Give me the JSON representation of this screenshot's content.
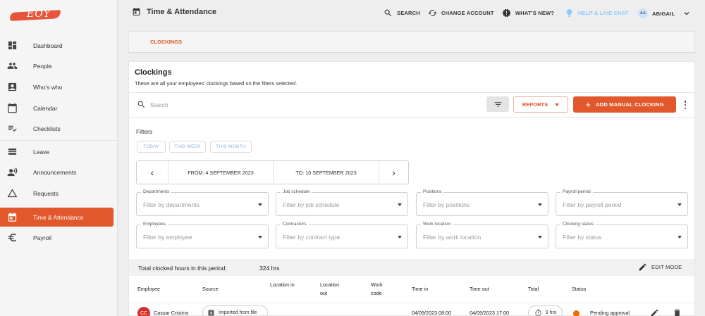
{
  "logo": {
    "text": "EOY"
  },
  "sidebar": {
    "items": [
      {
        "label": "Dashboard",
        "icon": "dashboard-icon"
      },
      {
        "label": "People",
        "icon": "people-icon"
      },
      {
        "label": "Who's who",
        "icon": "badge-icon"
      },
      {
        "label": "Calendar",
        "icon": "calendar-icon"
      },
      {
        "label": "Checklists",
        "icon": "checklist-icon"
      },
      {
        "label": "Leave",
        "icon": "leave-icon"
      },
      {
        "label": "Announcements",
        "icon": "announcement-icon"
      },
      {
        "label": "Requests",
        "icon": "requests-icon"
      },
      {
        "label": "Time & Attendance",
        "icon": "time-attendance-icon",
        "active": true
      },
      {
        "label": "Payroll",
        "icon": "euro-icon"
      }
    ]
  },
  "header": {
    "title": "Time & Attendance",
    "search": "SEARCH",
    "change_account": "CHANGE ACCOUNT",
    "whats_new": "WHAT'S NEW?",
    "help": "HELP & LIVE CHAT",
    "user_initials": "AA",
    "user_name": "ABIGAIL"
  },
  "tabs": {
    "active": "CLOCKINGS"
  },
  "card": {
    "title": "Clockings",
    "subtitle": "These are all your employees' clockings based on the filters selected."
  },
  "toolbar": {
    "search_placeholder": "Search",
    "reports_label": "REPORTS",
    "add_label": "ADD MANUAL CLOCKING"
  },
  "filters": {
    "label": "Filters",
    "chips": [
      "TODAY",
      "THIS WEEK",
      "THIS MONTH"
    ],
    "from": "FROM: 4 SEPTEMBER 2023",
    "to": "TO: 10 SEPTEMBER 2023",
    "selects": [
      {
        "label": "Departments",
        "placeholder": "Filter by departments"
      },
      {
        "label": "Job schedule",
        "placeholder": "Filter by job schedule"
      },
      {
        "label": "Positions",
        "placeholder": "Filter by positions"
      },
      {
        "label": "Payroll period",
        "placeholder": "Filter by payroll period"
      },
      {
        "label": "Employees",
        "placeholder": "Filter by employee"
      },
      {
        "label": "Contractors",
        "placeholder": "Filter by contract type"
      },
      {
        "label": "Work location",
        "placeholder": "Filter by work location"
      },
      {
        "label": "Clocking status",
        "placeholder": "Filter by status"
      }
    ]
  },
  "totals": {
    "label": "Total clocked hours in this period:",
    "value": "324 hrs",
    "edit_mode": "EDIT MODE"
  },
  "table": {
    "headers": {
      "employee": "Employee",
      "source": "Source",
      "location_in": "Location in",
      "location_out": "Location out",
      "work_code": "Work code",
      "time_in": "Time in",
      "time_out": "Time out",
      "total": "Total",
      "status": "Status"
    },
    "rows": [
      {
        "initials": "CC",
        "employee": "Cassar Cristina",
        "source": "Imported from file",
        "time_in": "04/09/2023 08:00",
        "time_out": "04/09/2023 17:00",
        "total": "9 hrs",
        "status": "Pending approval",
        "status_color": "#ef6c00"
      }
    ]
  },
  "colors": {
    "accent": "#e0582c",
    "link_muted": "#90caf9"
  }
}
